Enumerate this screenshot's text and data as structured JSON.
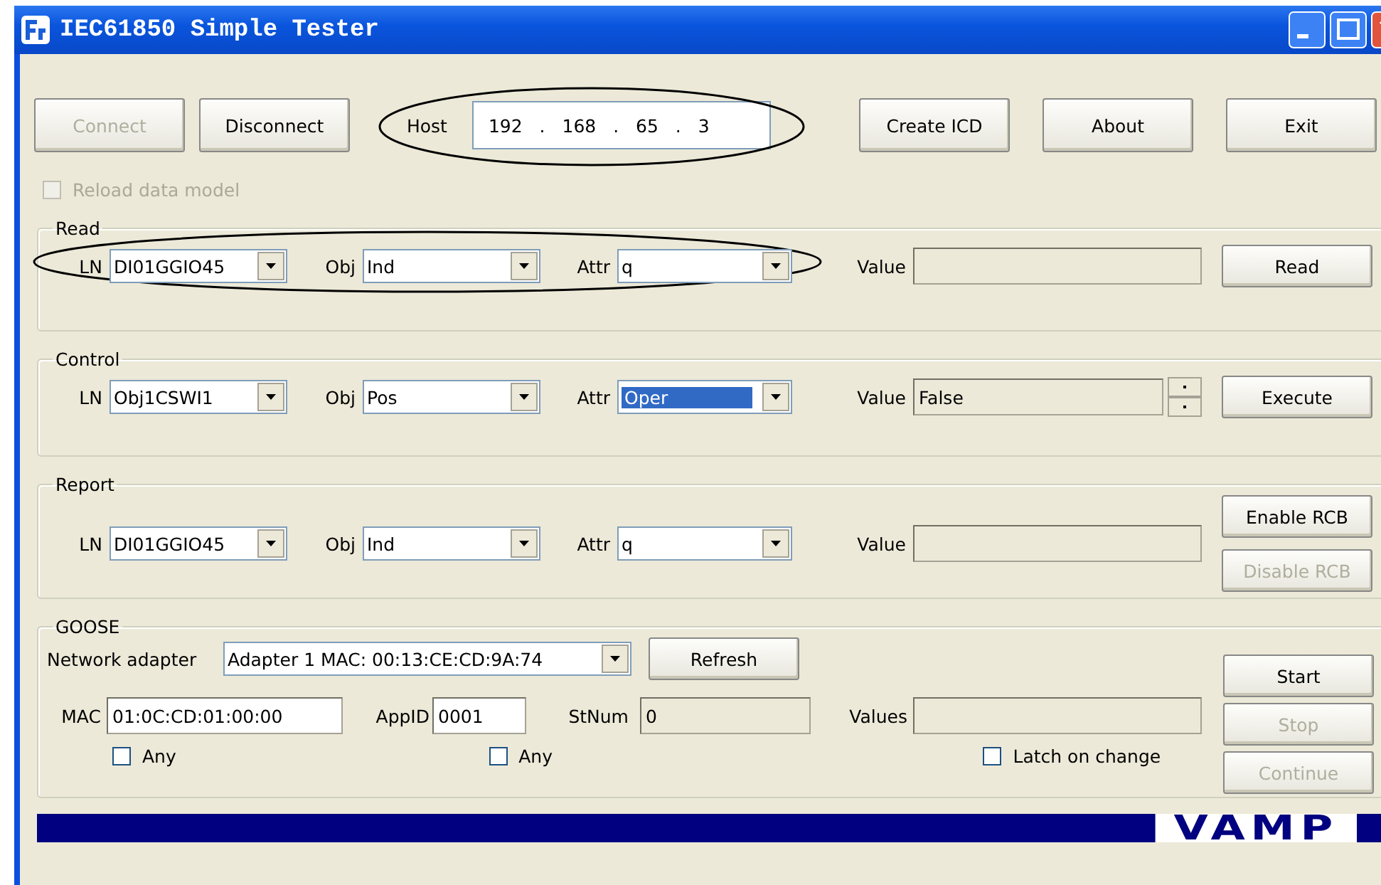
{
  "window": {
    "title": "IEC61850 Simple Tester"
  },
  "top_buttons": [
    {
      "label": "Connect",
      "disabled": true
    },
    {
      "label": "Disconnect",
      "disabled": false
    }
  ],
  "host": {
    "label": "Host",
    "value": "192 . 168 . 65 . 3",
    "circled": true
  },
  "right_buttons": [
    {
      "label": "Create ICD",
      "disabled": false
    },
    {
      "label": "About",
      "disabled": false
    },
    {
      "label": "Exit",
      "disabled": false
    }
  ],
  "reload": {
    "label": "Reload data model",
    "checked": false,
    "disabled": true
  },
  "sections": [
    {
      "title": "Read",
      "circled": true,
      "fields": [
        {
          "label": "LN",
          "value": "DI01GGIO45",
          "highlighted": false
        },
        {
          "label": "Obj",
          "value": "Ind",
          "highlighted": false
        },
        {
          "label": "Attr",
          "value": "q",
          "highlighted": false
        }
      ],
      "value_label": "Value",
      "spinner": false,
      "buttons": [
        {
          "label": "Read",
          "disabled": false
        }
      ]
    },
    {
      "title": "Control",
      "circled": false,
      "fields": [
        {
          "label": "LN",
          "value": "Obj1CSWI1",
          "highlighted": false
        },
        {
          "label": "Obj",
          "value": "Pos",
          "highlighted": false
        },
        {
          "label": "Attr",
          "value": "Oper",
          "highlighted": true
        }
      ],
      "value_label": "Value",
      "value": "False",
      "spinner": true,
      "buttons": [
        {
          "label": "Execute",
          "disabled": false
        }
      ]
    },
    {
      "title": "Report",
      "circled": false,
      "fields": [
        {
          "label": "LN",
          "value": "DI01GGIO45",
          "highlighted": false
        },
        {
          "label": "Obj",
          "value": "Ind",
          "highlighted": false
        },
        {
          "label": "Attr",
          "value": "q",
          "highlighted": false
        }
      ],
      "value_label": "Value",
      "spinner": false,
      "buttons": [
        {
          "label": "Enable RCB",
          "disabled": false
        },
        {
          "label": "Disable RCB",
          "disabled": true
        }
      ]
    }
  ],
  "goose": {
    "title": "GOOSE",
    "adapter_label": "Network adapter",
    "adapter": "Adapter 1 MAC: 00:13:CE:CD:9A:74",
    "refresh": "Refresh",
    "mac": {
      "label": "MAC",
      "value": "01:0C:CD:01:00:00"
    },
    "appid": {
      "label": "AppID",
      "value": "0001"
    },
    "stnum": {
      "label": "StNum",
      "value": "0"
    },
    "values_label": "Values",
    "checkboxes": [
      {
        "label": "Any",
        "checked": false
      },
      {
        "label": "Any",
        "checked": false
      },
      {
        "label": "Latch on change",
        "checked": false
      }
    ],
    "buttons": [
      {
        "label": "Start",
        "disabled": false
      },
      {
        "label": "Stop",
        "disabled": true
      },
      {
        "label": "Continue",
        "disabled": true
      }
    ]
  },
  "brand": "VAMP"
}
